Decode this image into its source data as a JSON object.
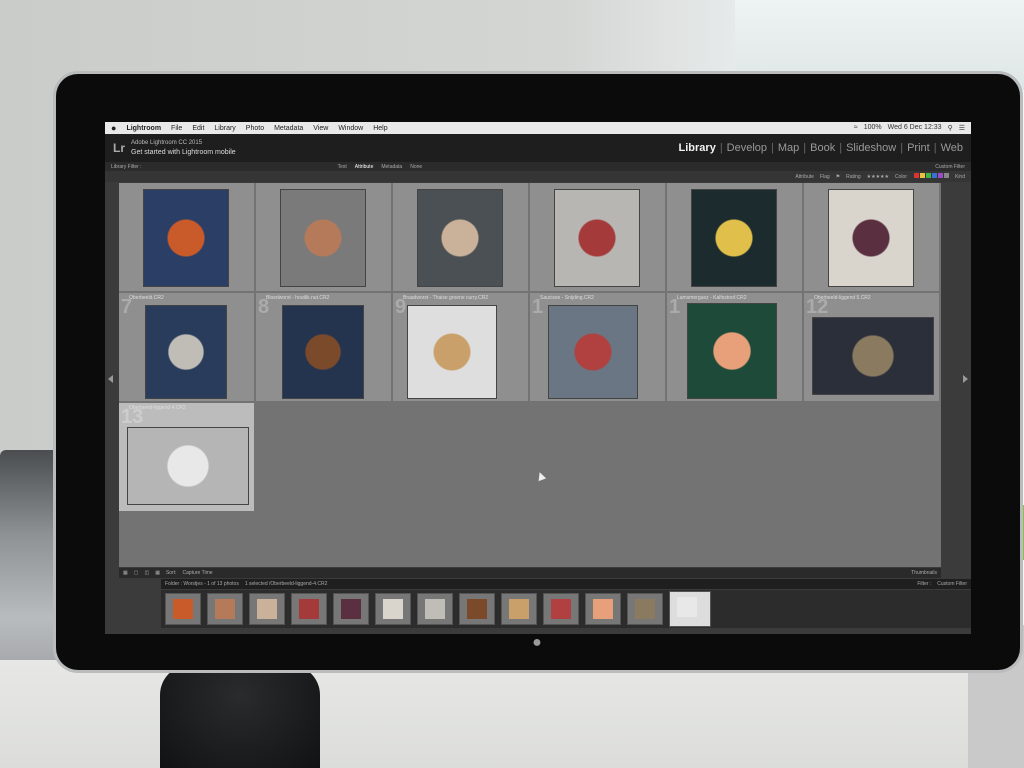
{
  "menubar": {
    "app": "Lightroom",
    "items": [
      "File",
      "Edit",
      "Library",
      "Photo",
      "Metadata",
      "View",
      "Window",
      "Help"
    ],
    "battery": "100%",
    "datetime": "Wed 6 Dec 12:33"
  },
  "identity": {
    "product": "Adobe Lightroom CC 2015",
    "tagline": "Get started with Lightroom mobile"
  },
  "modules": [
    "Library",
    "Develop",
    "Map",
    "Book",
    "Slideshow",
    "Print",
    "Web"
  ],
  "filter": {
    "label": "Library Filter :",
    "tabs": [
      "Text",
      "Attribute",
      "Metadata",
      "None"
    ],
    "active": "Attribute",
    "preset": "Custom Filter",
    "attr_label": "Attribute",
    "flag": "Flag",
    "rating": "Rating",
    "color": "Color",
    "kind": "Kind"
  },
  "colors": [
    "#d33",
    "#e8c43a",
    "#3fb34a",
    "#3b6fd8",
    "#9a4cc5",
    "#888"
  ],
  "grid": [
    {
      "num": "",
      "name": "",
      "thumb": "#c95a2a",
      "bg": "#2b3e66"
    },
    {
      "num": "",
      "name": "",
      "thumb": "#b57a5a",
      "bg": "#7a7a7a"
    },
    {
      "num": "",
      "name": "",
      "thumb": "#c9b299",
      "bg": "#4b5054"
    },
    {
      "num": "",
      "name": "",
      "thumb": "#a43a3a",
      "bg": "#b8b6b2"
    },
    {
      "num": "",
      "name": "",
      "thumb": "#e0c04a",
      "bg": "#1c2b2e"
    },
    {
      "num": "",
      "name": "",
      "thumb": "#5a3040",
      "bg": "#d9d4cc"
    },
    {
      "num": "7",
      "name": "Oberbeeld.CR2",
      "thumb": "#c0bdb7",
      "bg": "#2a3c5c"
    },
    {
      "num": "8",
      "name": "Bloedworst - houtlik.nut.CR2",
      "thumb": "#7a4a2a",
      "bg": "#24344f"
    },
    {
      "num": "9",
      "name": "Braadworst - Thaise groene curry.CR2",
      "thumb": "#caa06a",
      "bg": "#dedede"
    },
    {
      "num": "1",
      "name": "Saucisse - Snijding.CR2",
      "thumb": "#b14040",
      "bg": "#6a7684"
    },
    {
      "num": "1",
      "name": "Lamsmerguez - Kalfsstoof.CR2",
      "thumb": "#e8a07a",
      "bg": "#1e4a3a"
    },
    {
      "num": "12",
      "name": "Oberbeeld-liggend 5.CR2",
      "thumb": "#8a7a60",
      "bg": "#2a2f3a"
    },
    {
      "num": "13",
      "name": "Oberbeeld-liggend 4.CR2",
      "thumb": "#e8e8e8",
      "bg": "#b5b5b5"
    }
  ],
  "toolbar": {
    "sort_label": "Sort:",
    "sort_value": "Capture Time",
    "thumbs": "Thumbnails"
  },
  "filmbar": {
    "folder": "Folder : Worstjes - 1 of 13 photos",
    "selected": "1 selected /Oberbeeld-liggend-4.CR2",
    "filter_label": "Filter :",
    "filter_value": "Custom Filter"
  },
  "filmstrip": [
    "#c95a2a",
    "#b57a5a",
    "#c9b299",
    "#a43a3a",
    "#5a3040",
    "#d9d4cc",
    "#c0bdb7",
    "#7a4a2a",
    "#caa06a",
    "#b14040",
    "#e8a07a",
    "#8a7a60",
    "#e8e8e8"
  ]
}
